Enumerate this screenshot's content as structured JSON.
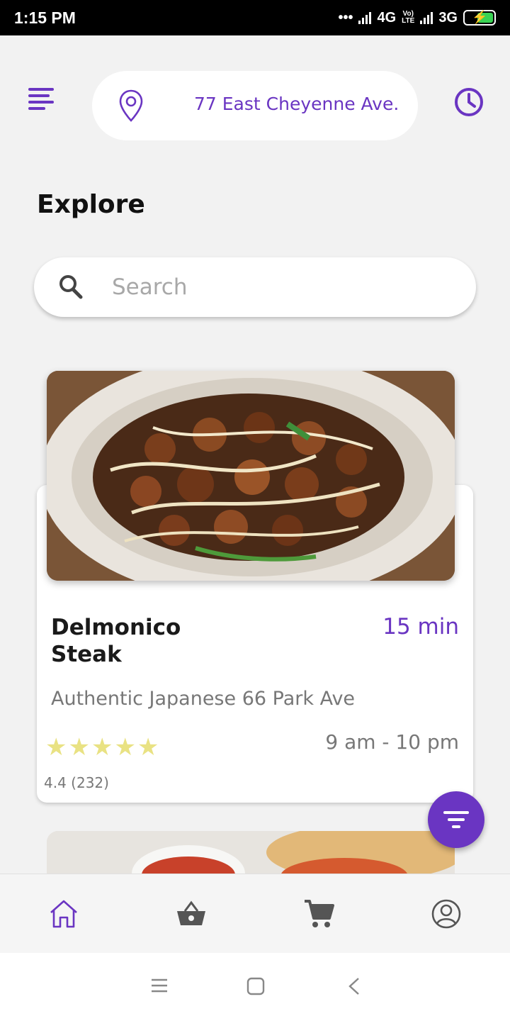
{
  "status_bar": {
    "time": "1:15 PM",
    "network_1": "4G",
    "network_2": "3G",
    "volte_line1": "Vo)",
    "volte_line2": "LTE"
  },
  "header": {
    "location": "77 East Cheyenne Ave...."
  },
  "page_title": "Explore",
  "search": {
    "placeholder": "Search",
    "value": ""
  },
  "card": {
    "title_line1": "Delmonico",
    "title_line2": "Steak",
    "time": "15 min",
    "subtitle": "Authentic Japanese 66 Park Ave",
    "stars": "★★★★★",
    "hours": "9 am - 10 pm",
    "rating": "4.4 (232)"
  },
  "bottom_nav": [
    "home-icon",
    "basket-icon",
    "cart-icon",
    "profile-icon"
  ],
  "colors": {
    "accent": "#6a35c2",
    "stars": "#e9e283",
    "background": "#f2f2f2"
  }
}
